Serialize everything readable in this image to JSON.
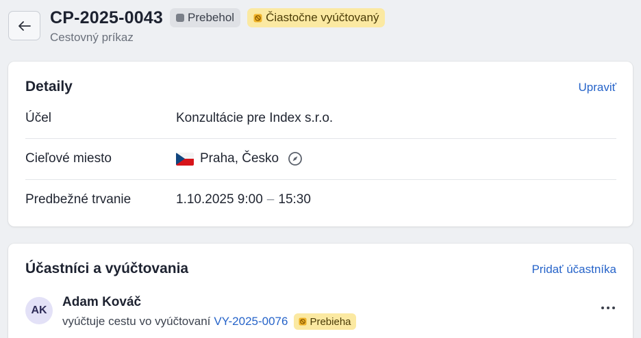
{
  "header": {
    "back_icon": "arrow-left-icon",
    "title": "CP-2025-0043",
    "subtitle": "Cestovný príkaz",
    "status_badge": "Prebehol",
    "billing_badge": "Čiastočne vyúčtovaný",
    "billing_badge_icon": "no-entry-icon"
  },
  "details": {
    "title": "Detaily",
    "edit_label": "Upraviť",
    "rows": [
      {
        "label": "Účel",
        "value": "Konzultácie pre Index s.r.o."
      },
      {
        "label": "Cieľové miesto",
        "value": "Praha, Česko",
        "icon": "cz-flag-icon",
        "trailing_icon": "compass-icon"
      },
      {
        "label": "Predbežné trvanie",
        "value_start": "1.10.2025 9:00",
        "separator": "–",
        "value_end": "15:30"
      }
    ]
  },
  "participants": {
    "title": "Účastníci a vyúčtovania",
    "add_label": "Pridať účastníka",
    "items": [
      {
        "initials": "AK",
        "name": "Adam Kováč",
        "description": "vyúčtuje cestu vo vyúčtovaní",
        "link": "VY-2025-0076",
        "badge": "Prebieha",
        "menu_icon": "more-horizontal-icon"
      }
    ]
  },
  "colors": {
    "accent": "#2563c9",
    "badge_yellow": "#fbe9a2",
    "badge_gray": "#dfe1e5"
  }
}
